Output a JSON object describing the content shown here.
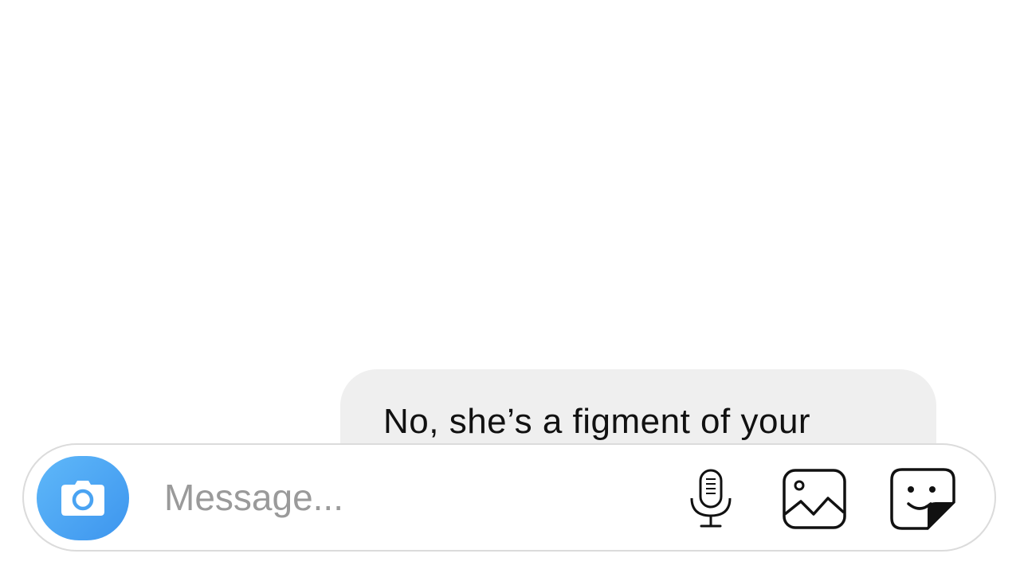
{
  "thread": {
    "messages": [
      {
        "text": "No, she’s a figment of your"
      }
    ]
  },
  "composer": {
    "placeholder": "Message...",
    "value": "",
    "camera_icon": "camera-icon",
    "mic_icon": "microphone-icon",
    "gallery_icon": "gallery-icon",
    "sticker_icon": "sticker-icon"
  },
  "colors": {
    "accent": "#3d95ee",
    "bubble": "#efefef",
    "placeholder": "#9a9a9a",
    "border": "#dbdbdb"
  }
}
